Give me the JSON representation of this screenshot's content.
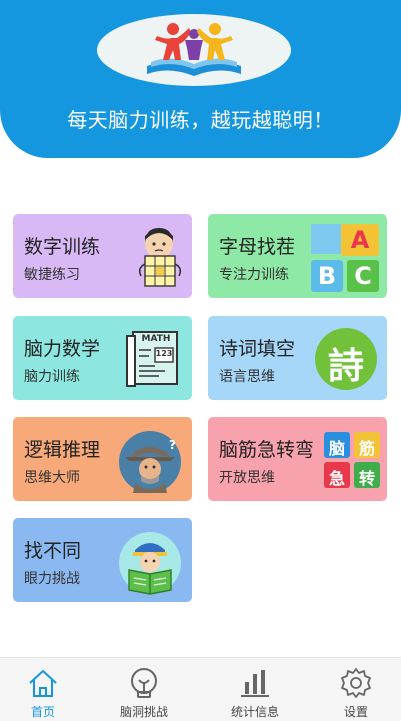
{
  "header": {
    "slogan": "每天脑力训练，越玩越聪明！"
  },
  "cards": {
    "digit": {
      "title": "数字训练",
      "subtitle": "敏捷练习"
    },
    "letter": {
      "title": "字母找茬",
      "subtitle": "专注力训练",
      "tiles": [
        "A",
        "B",
        "C"
      ]
    },
    "math": {
      "title": "脑力数学",
      "subtitle": "脑力训练",
      "book_text": "MATH",
      "book_num": "123"
    },
    "poem": {
      "title": "诗词填空",
      "subtitle": "语言思维",
      "glyph": "詩"
    },
    "logic": {
      "title": "逻辑推理",
      "subtitle": "思维大师"
    },
    "riddle": {
      "title": "脑筋急转弯",
      "subtitle": "开放思维",
      "tiles": [
        "脑",
        "筋",
        "急",
        "转"
      ]
    },
    "diff": {
      "title": "找不同",
      "subtitle": "眼力挑战"
    }
  },
  "tabbar": {
    "items": [
      {
        "label": "首页",
        "icon": "home-icon",
        "active": true
      },
      {
        "label": "脑洞挑战",
        "icon": "bulb-icon",
        "active": false
      },
      {
        "label": "统计信息",
        "icon": "bar-chart-icon",
        "active": false
      },
      {
        "label": "设置",
        "icon": "gear-icon",
        "active": false
      }
    ]
  },
  "colors": {
    "primary": "#1597e0",
    "card_digit": "#d9b9f5",
    "card_letter": "#8ee8a6",
    "card_math": "#8ee6e0",
    "card_poem": "#a6d6f8",
    "card_logic": "#f7a97a",
    "card_riddle": "#f7a2ad",
    "card_diff": "#8ab9f2"
  }
}
